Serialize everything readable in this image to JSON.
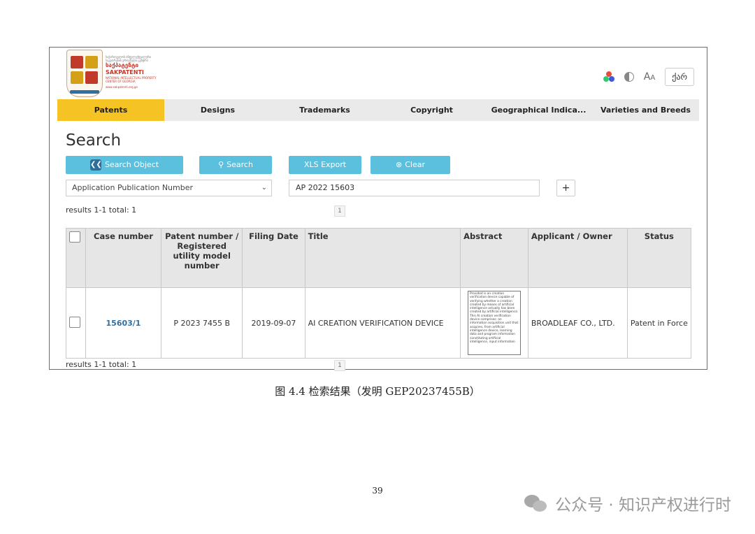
{
  "logo": {
    "header_small_1": "საქართველოს ინტელექტუალური",
    "header_small_2": "საკუთრების ეროვნული ცენტრი",
    "name_geo": "საქპატენტი",
    "name_lat": "SAKPATENTI",
    "sub_1": "NATIONAL INTELLECTUAL PROPERTY",
    "sub_2": "CENTER OF GEORGIA",
    "url": "www.sakpatenti.org.ge"
  },
  "toolbar": {
    "language_label": "ქარ",
    "font_icon_label": "A",
    "font_icon_small": "A"
  },
  "nav": {
    "tabs": [
      {
        "label": "Patents"
      },
      {
        "label": "Designs"
      },
      {
        "label": "Trademarks"
      },
      {
        "label": "Copyright"
      },
      {
        "label": "Geographical Indica..."
      },
      {
        "label": "Varieties and Breeds"
      }
    ]
  },
  "search": {
    "title": "Search",
    "buttons": {
      "search_object": "Search Object",
      "search": "Search",
      "xls_export": "XLS Export",
      "clear": "Clear"
    },
    "field_select": "Application Publication Number",
    "query_value": "AP 2022 15603",
    "plus_label": "+"
  },
  "results": {
    "summary": "results 1-1 total: 1",
    "page": "1"
  },
  "table": {
    "headers": {
      "case_number": "Case number",
      "patent_number": "Patent number / Registered utility model number",
      "filing_date": "Filing Date",
      "title": "Title",
      "abstract": "Abstract",
      "applicant": "Applicant / Owner",
      "status": "Status"
    },
    "rows": [
      {
        "case_number": "15603/1",
        "patent_number": "P 2023 7455 B",
        "filing_date": "2019-09-07",
        "title": "AI CREATION VERIFICATION DEVICE",
        "abstract": "Provided is an creation verification device capable of verifying whether a creation created by means of artificial intelligence actually has been created by artificial intelligence. This AI creation verification device comprises: an information acquisition unit that acquires, from artificial intelligence device, learning data and program information constituting artificial intelligence, input information",
        "applicant": "BROADLEAF CO., LTD.",
        "status": "Patent in Force"
      }
    ]
  },
  "caption": "图 4.4  检索结果（发明 GEP20237455B）",
  "page_number": "39",
  "watermark": "公众号 · 知识产权进行时",
  "colors": {
    "active_tab": "#f6c324",
    "button": "#5bc0de",
    "link": "#2f6fa3",
    "nav_bg": "#eaeaea"
  }
}
